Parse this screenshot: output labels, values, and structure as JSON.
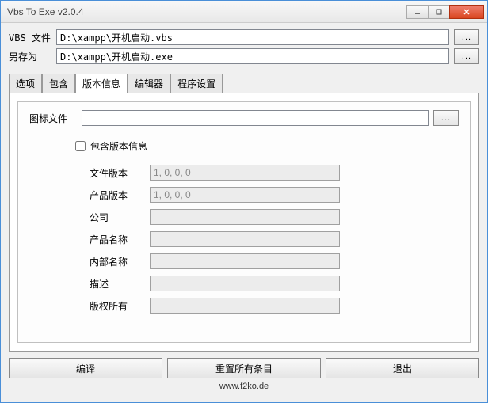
{
  "window": {
    "title": "Vbs To Exe v2.0.4"
  },
  "files": {
    "vbs_label": "VBS 文件",
    "vbs_value": "D:\\xampp\\开机启动.vbs",
    "saveas_label": "另存为",
    "saveas_value": "D:\\xampp\\开机启动.exe",
    "browse": "..."
  },
  "tabs": {
    "options": "选项",
    "include": "包含",
    "version": "版本信息",
    "editor": "编辑器",
    "program": "程序设置"
  },
  "version": {
    "icon_label": "图标文件",
    "icon_value": "",
    "include_checkbox": "包含版本信息",
    "file_version_label": "文件版本",
    "file_version_value": "1, 0, 0, 0",
    "product_version_label": "产品版本",
    "product_version_value": "1, 0, 0, 0",
    "company_label": "公司",
    "company_value": "",
    "product_name_label": "产品名称",
    "product_name_value": "",
    "internal_name_label": "内部名称",
    "internal_name_value": "",
    "description_label": "描述",
    "description_value": "",
    "copyright_label": "版权所有",
    "copyright_value": ""
  },
  "buttons": {
    "compile": "编译",
    "reset": "重置所有条目",
    "exit": "退出"
  },
  "footer": {
    "link": "www.f2ko.de"
  }
}
